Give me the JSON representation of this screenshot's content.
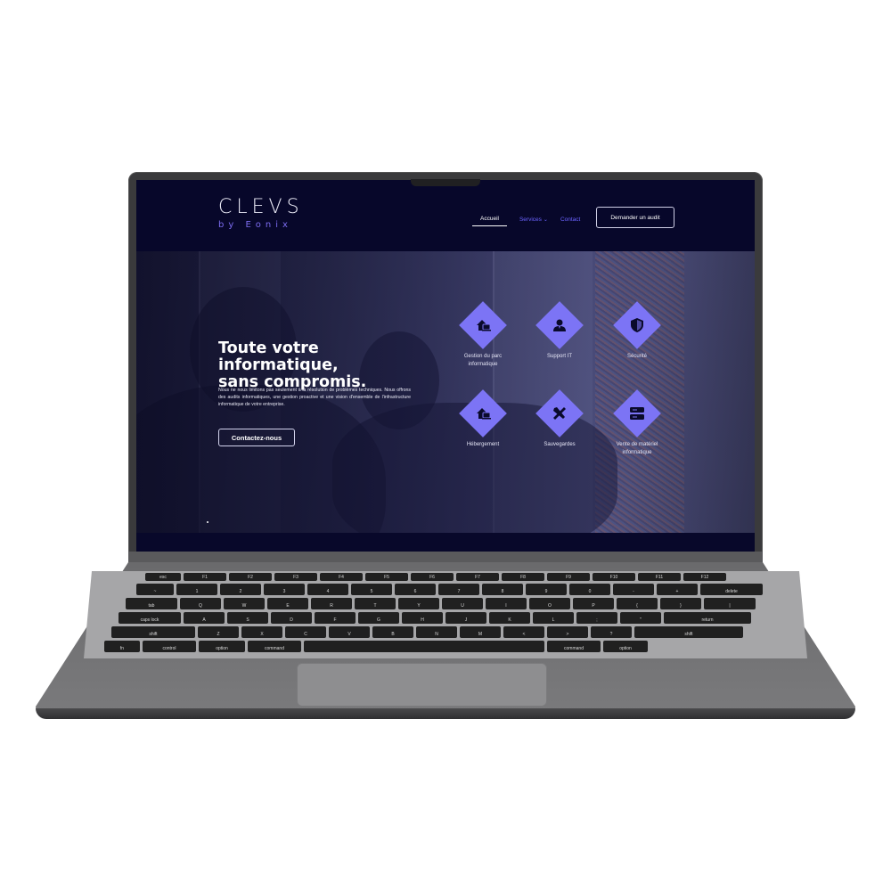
{
  "site": {
    "logo": {
      "main": "CLEVS",
      "sub": "by Eonix"
    },
    "nav": {
      "items": [
        {
          "label": "Accueil",
          "active": true
        },
        {
          "label": "Services",
          "has_dropdown": true
        },
        {
          "label": "Contact"
        }
      ],
      "cta_label": "Demander un audit"
    },
    "hero": {
      "title_line1": "Toute votre informatique,",
      "title_line2": "sans compromis.",
      "description": "Nous ne nous limitons pas seulement à la résolution de problèmes techniques. Nous offrons des audits informatiques, une gestion proactive et une vision d'ensemble de l'infrastructure informatique de votre entreprise.",
      "cta_label": "Contactez-nous"
    },
    "services": [
      {
        "label_line1": "Gestion du parc",
        "label_line2": "informatique",
        "icon": "home-laptop-icon"
      },
      {
        "label_line1": "Support IT",
        "label_line2": "",
        "icon": "support-person-icon"
      },
      {
        "label_line1": "Sécurité",
        "label_line2": "",
        "icon": "shield-icon"
      },
      {
        "label_line1": "Hébergement",
        "label_line2": "",
        "icon": "home-laptop-icon"
      },
      {
        "label_line1": "Sauvegardes",
        "label_line2": "",
        "icon": "tools-icon"
      },
      {
        "label_line1": "Vente de matériel",
        "label_line2": "informatique",
        "icon": "server-icon"
      }
    ],
    "colors": {
      "background": "#07072a",
      "accent": "#7c74f5",
      "nav_link": "#6b63ff"
    }
  },
  "keyboard": {
    "row_fn": [
      "esc",
      "F1",
      "F2",
      "F3",
      "F4",
      "F5",
      "F6",
      "F7",
      "F8",
      "F9",
      "F10",
      "F11",
      "F12"
    ],
    "row_num": [
      "~",
      "1",
      "2",
      "3",
      "4",
      "5",
      "6",
      "7",
      "8",
      "9",
      "0",
      "-",
      "+",
      "delete"
    ],
    "row_q": [
      "tab",
      "Q",
      "W",
      "E",
      "R",
      "T",
      "Y",
      "U",
      "I",
      "O",
      "P",
      "{",
      "}",
      "|"
    ],
    "row_a": [
      "caps lock",
      "A",
      "S",
      "D",
      "F",
      "G",
      "H",
      "J",
      "K",
      "L",
      ";",
      "\"",
      "return"
    ],
    "row_z": [
      "shift",
      "Z",
      "X",
      "C",
      "V",
      "B",
      "N",
      "M",
      "<",
      ">",
      "?",
      "shift"
    ],
    "row_bottom": [
      "fn",
      "control",
      "option",
      "command",
      "",
      "command",
      "option"
    ]
  }
}
